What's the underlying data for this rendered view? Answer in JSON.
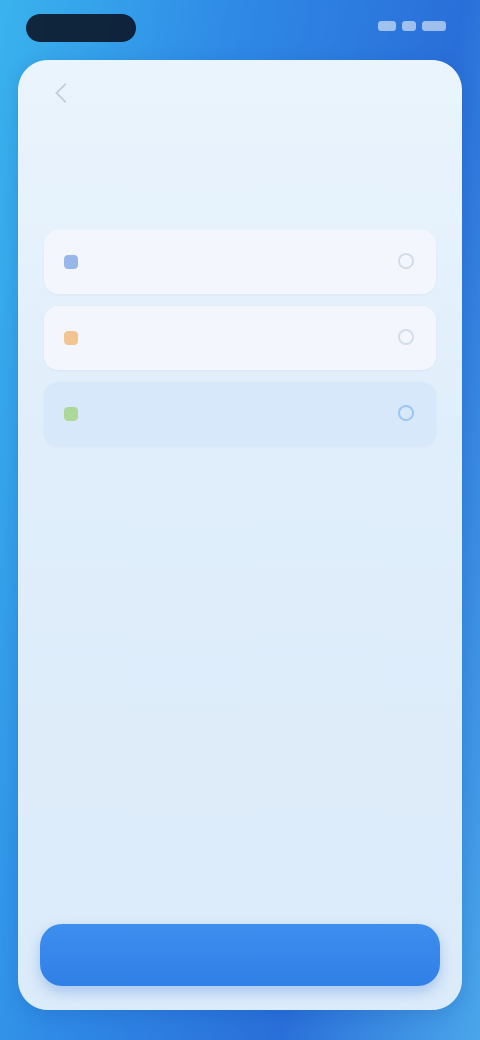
{
  "header": {
    "title": "",
    "subtitle": ""
  },
  "options": [
    {
      "label": "",
      "icon": "blue-square-icon",
      "color": "#4a82d8",
      "selected": false
    },
    {
      "label": "",
      "icon": "orange-square-icon",
      "color": "#f2a24b",
      "selected": false
    },
    {
      "label": "",
      "icon": "green-square-icon",
      "color": "#8fcf5a",
      "selected": true
    }
  ],
  "footer": {
    "primary_label": ""
  },
  "colors": {
    "accent": "#2f7fe6",
    "background_gradient_start": "#3ab3ee",
    "card_background": "#e3eff9",
    "selected_option": "#d6e8f9"
  }
}
